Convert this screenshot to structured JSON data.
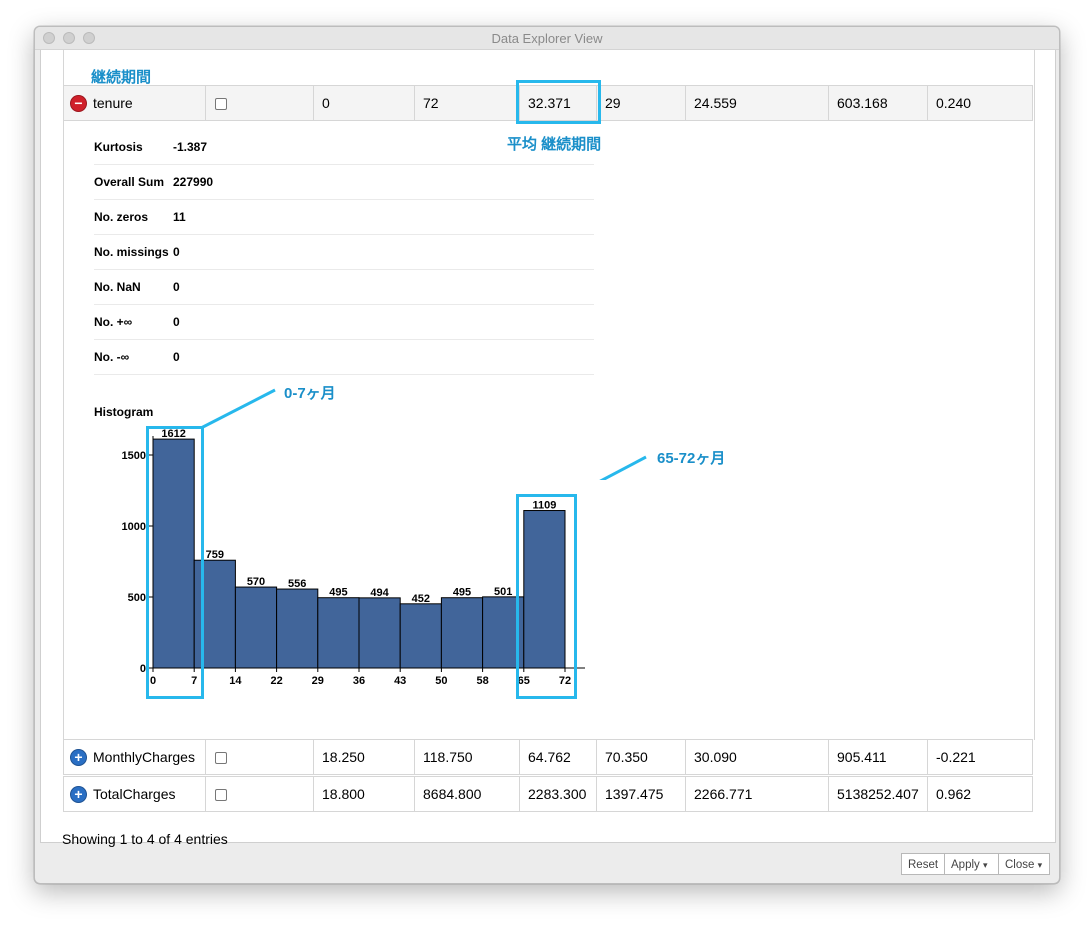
{
  "window": {
    "title": "Data Explorer View"
  },
  "annotations": {
    "section_label": "継続期間",
    "mean_label": "平均 継続期間",
    "range_low_label": "0-7ヶ月",
    "range_high_label": "65-72ヶ月",
    "highlight_color": "#27b8ec",
    "text_color": "#1a8fc9"
  },
  "rows": [
    {
      "name": "tenure",
      "expanded": true,
      "toggle": "−",
      "toggle_color": "#d0202a",
      "values": [
        "0",
        "72",
        "32.371",
        "29",
        "24.559",
        "603.168",
        "0.240"
      ]
    },
    {
      "name": "MonthlyCharges",
      "expanded": false,
      "toggle": "+",
      "toggle_color": "#2a6fc4",
      "values": [
        "18.250",
        "118.750",
        "64.762",
        "70.350",
        "30.090",
        "905.411",
        "-0.221"
      ]
    },
    {
      "name": "TotalCharges",
      "expanded": false,
      "toggle": "+",
      "toggle_color": "#2a6fc4",
      "values": [
        "18.800",
        "8684.800",
        "2283.300",
        "1397.475",
        "2266.771",
        "5138252.407",
        "0.962"
      ]
    }
  ],
  "details": [
    {
      "label": "Kurtosis",
      "value": "-1.387"
    },
    {
      "label": "Overall Sum",
      "value": "227990"
    },
    {
      "label": "No. zeros",
      "value": "11"
    },
    {
      "label": "No. missings",
      "value": "0"
    },
    {
      "label": "No. NaN",
      "value": "0"
    },
    {
      "label": "No. +∞",
      "value": "0"
    },
    {
      "label": "No. -∞",
      "value": "0"
    }
  ],
  "histogram_label": "Histogram",
  "chart_data": {
    "type": "bar",
    "bins": [
      [
        0,
        7
      ],
      [
        7,
        14
      ],
      [
        14,
        22
      ],
      [
        22,
        29
      ],
      [
        29,
        36
      ],
      [
        36,
        43
      ],
      [
        43,
        50
      ],
      [
        50,
        58
      ],
      [
        58,
        65
      ],
      [
        65,
        72
      ]
    ],
    "x_ticks": [
      0,
      7,
      14,
      22,
      29,
      36,
      43,
      50,
      58,
      65,
      72
    ],
    "values": [
      1612,
      759,
      570,
      556,
      495,
      494,
      452,
      495,
      501,
      1109
    ],
    "y_ticks": [
      0,
      500,
      1000,
      1500
    ],
    "ylim": [
      0,
      1650
    ],
    "bar_color": "#41659a"
  },
  "status": {
    "entries": "Showing 1 to 4 of 4 entries"
  },
  "footer": {
    "reset": "Reset",
    "apply": "Apply",
    "close": "Close",
    "caret": "▾"
  }
}
